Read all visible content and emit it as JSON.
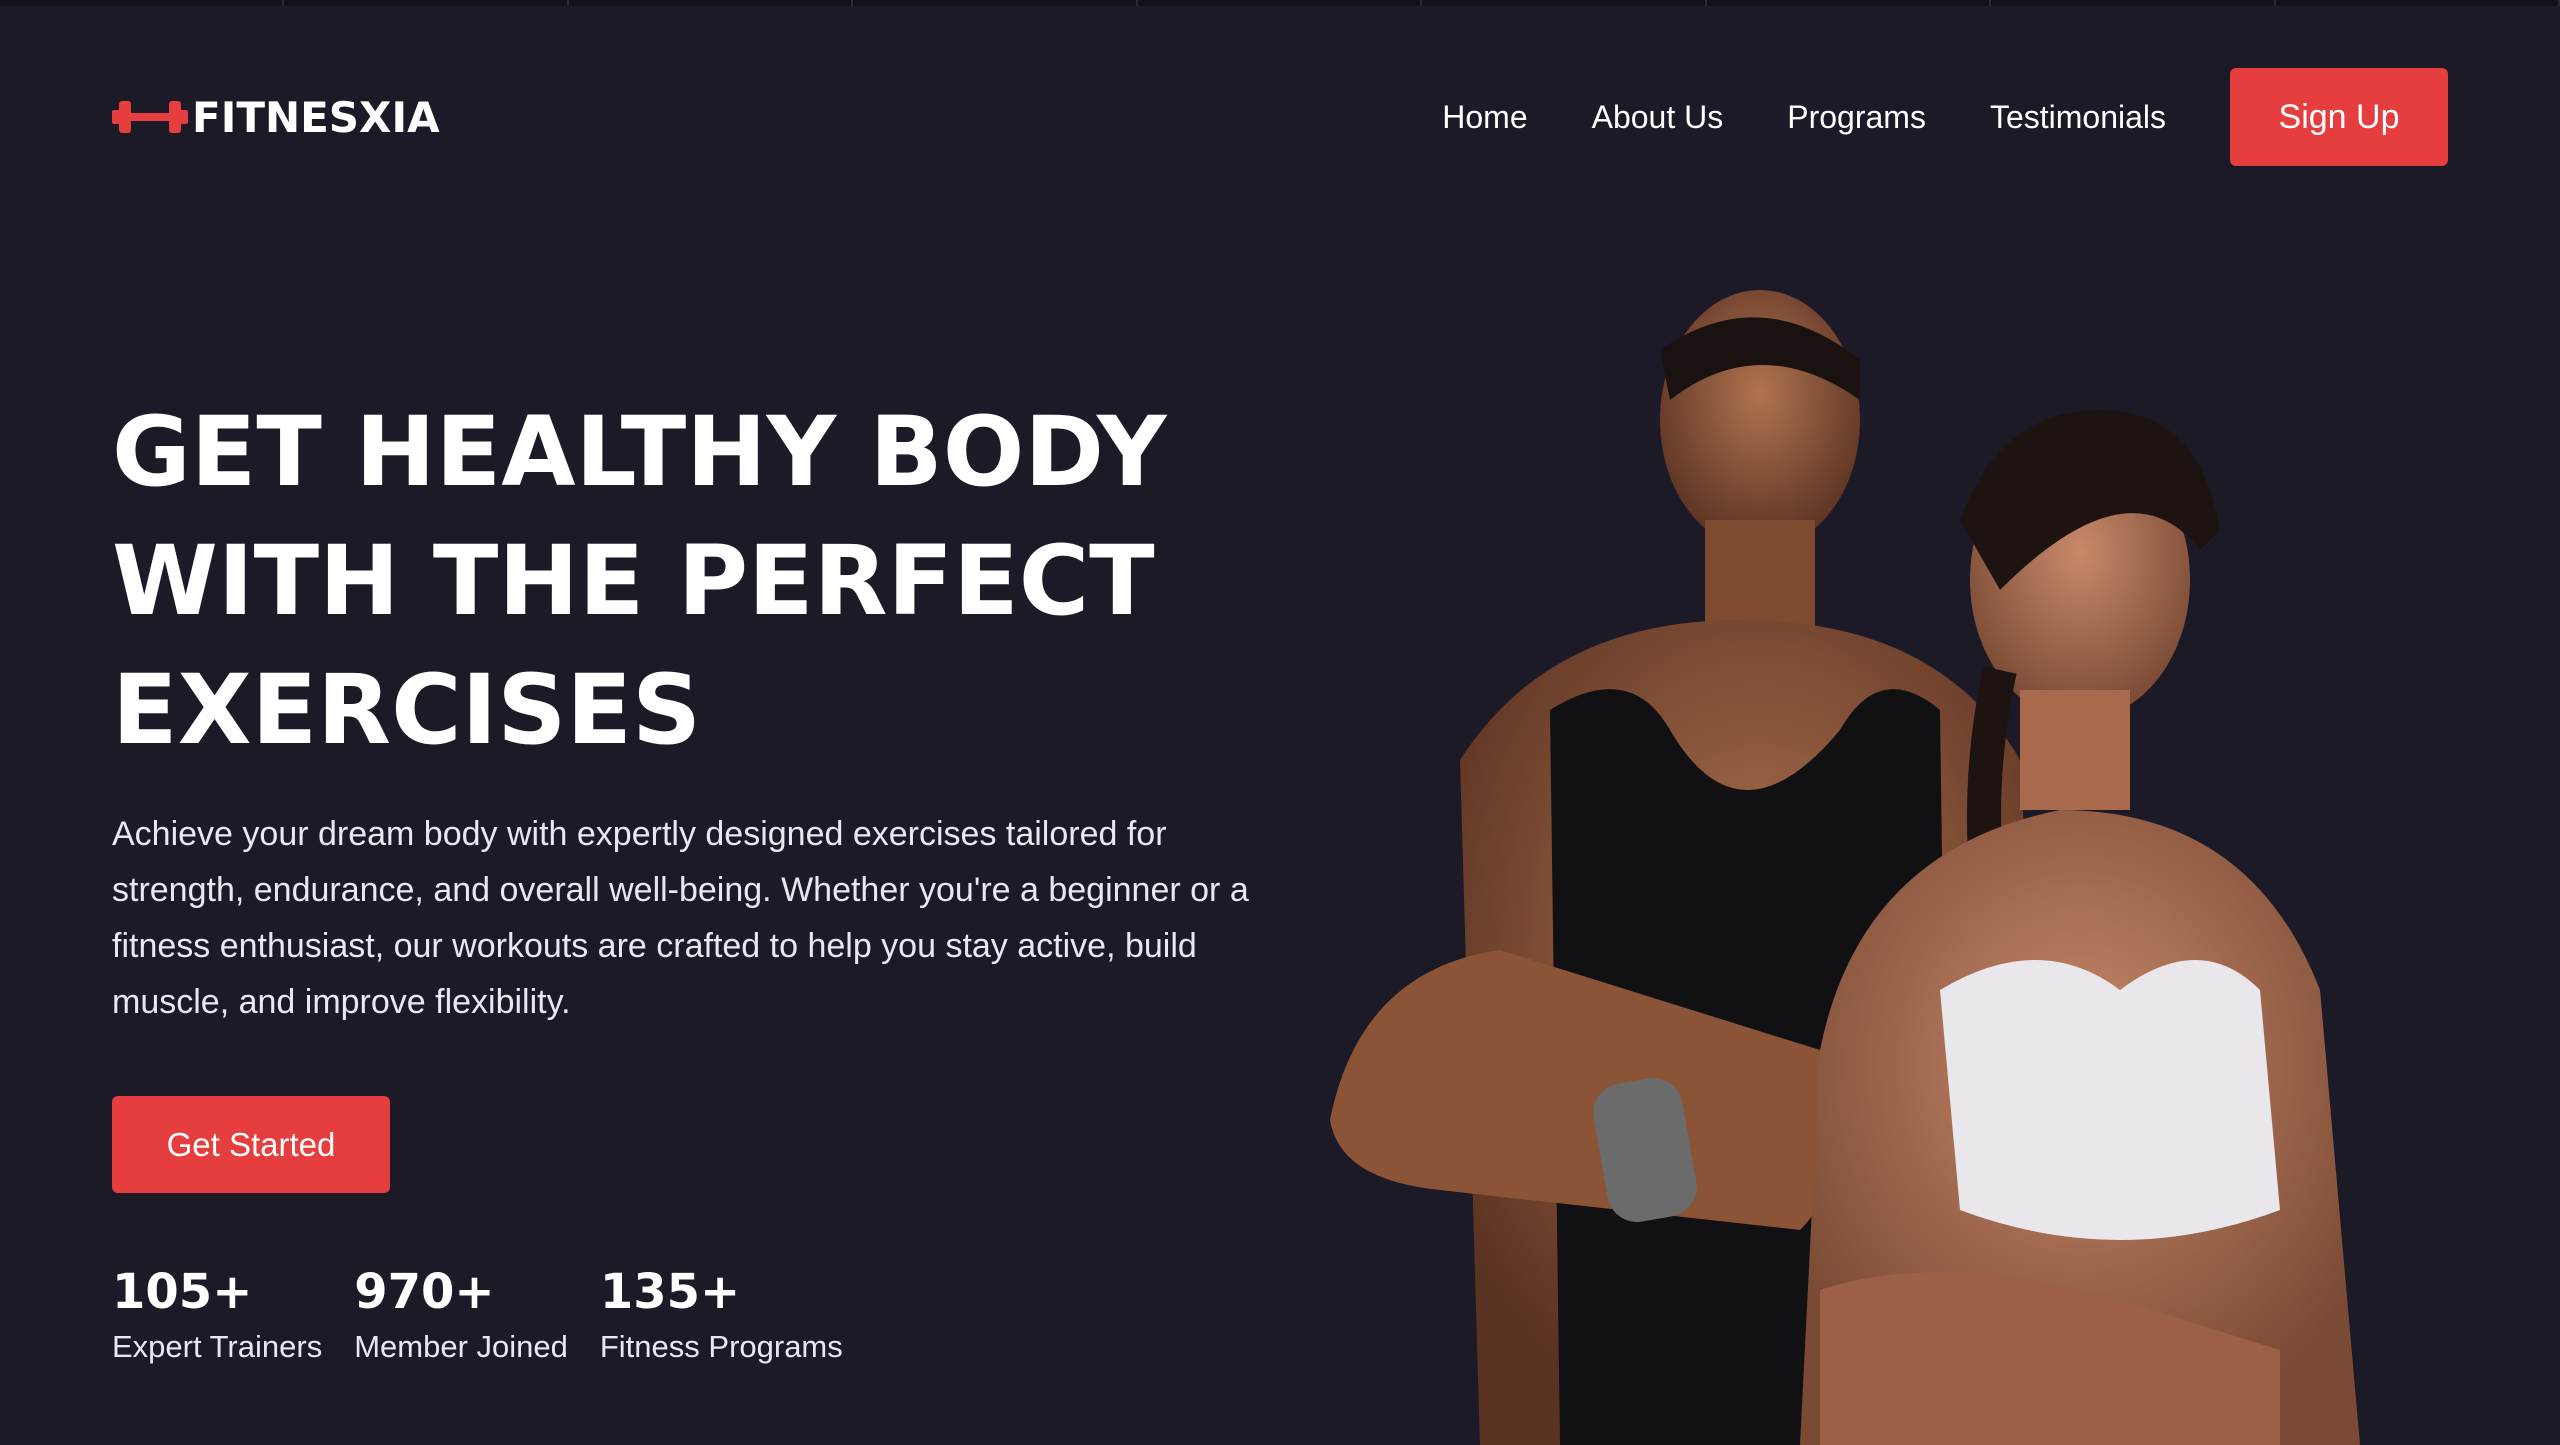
{
  "brand": {
    "name": "FITNESXIA",
    "icon": "dumbbell-icon",
    "accent_color": "#e63e3e",
    "background_color": "#1c1a27"
  },
  "nav": {
    "links": [
      "Home",
      "About Us",
      "Programs",
      "Testimonials"
    ],
    "signup_label": "Sign Up"
  },
  "hero": {
    "title_lines": [
      "GET HEALTHY BODY",
      "WITH THE PERFECT",
      "EXERCISES"
    ],
    "description": "Achieve your dream body with expertly designed exercises tailored for strength, endurance, and overall well-being. Whether you're a beginner or a fitness enthusiast, our workouts are crafted to help you stay active, build muscle, and improve flexibility.",
    "cta_label": "Get Started",
    "image": "athletes-photo"
  },
  "stats": [
    {
      "value": "105+",
      "label": "Expert Trainers"
    },
    {
      "value": "970+",
      "label": "Member Joined"
    },
    {
      "value": "135+",
      "label": "Fitness Programs"
    }
  ]
}
